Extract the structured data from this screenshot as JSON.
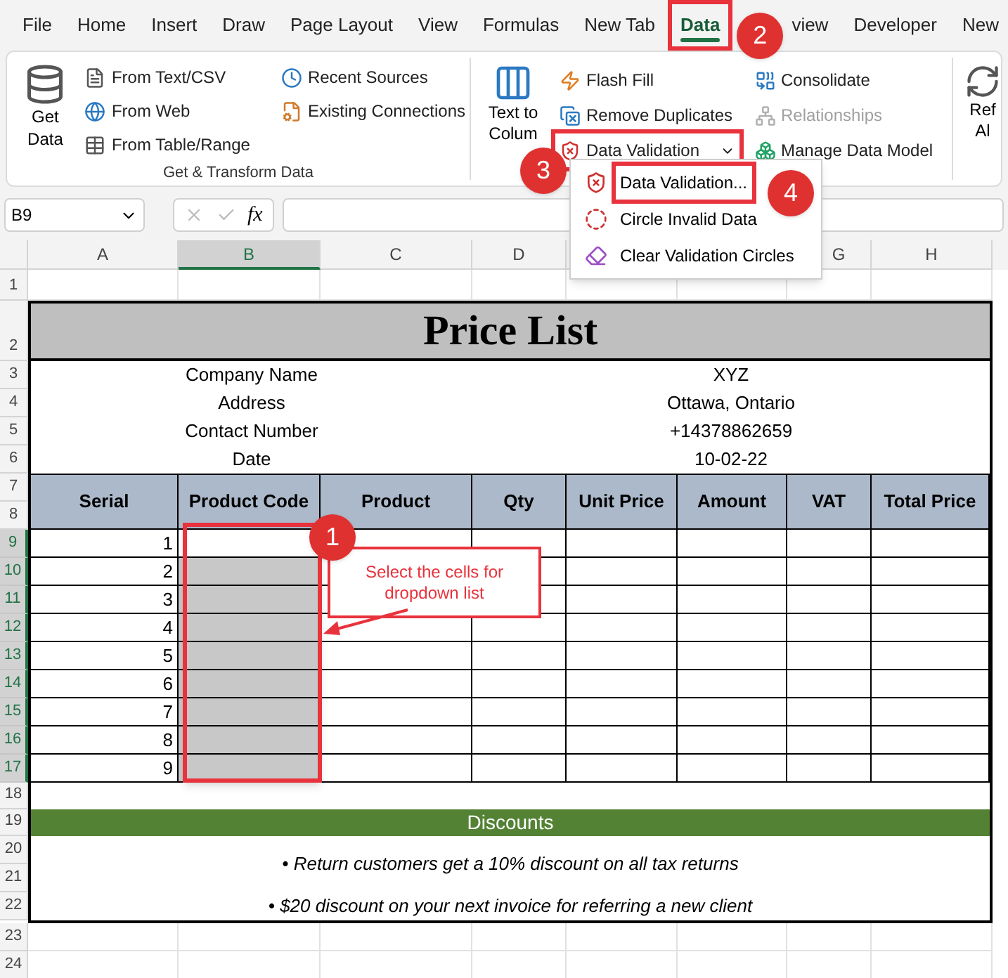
{
  "tabs": [
    {
      "label": "File",
      "selected": false,
      "highlighted": false
    },
    {
      "label": "Home",
      "selected": false,
      "highlighted": false
    },
    {
      "label": "Insert",
      "selected": false,
      "highlighted": false
    },
    {
      "label": "Draw",
      "selected": false,
      "highlighted": false
    },
    {
      "label": "Page Layout",
      "selected": false,
      "highlighted": false
    },
    {
      "label": "View",
      "selected": false,
      "highlighted": false
    },
    {
      "label": "Formulas",
      "selected": false,
      "highlighted": false
    },
    {
      "label": "New Tab",
      "selected": false,
      "highlighted": false
    },
    {
      "label": "Data",
      "selected": true,
      "highlighted": true
    },
    {
      "label": "view",
      "selected": false,
      "highlighted": false
    },
    {
      "label": "Developer",
      "selected": false,
      "highlighted": false
    },
    {
      "label": "New",
      "selected": false,
      "highlighted": false
    }
  ],
  "ribbon": {
    "get_data": {
      "label": "Get Data"
    },
    "get_items": [
      {
        "label": "From Text/CSV"
      },
      {
        "label": "From Web"
      },
      {
        "label": "From Table/Range"
      }
    ],
    "source_items": [
      {
        "label": "Recent Sources"
      },
      {
        "label": "Existing Connections"
      }
    ],
    "get_group_label": "Get & Transform Data",
    "text_to_columns": {
      "lines": [
        "Text to",
        "Colum"
      ]
    },
    "tool_items": [
      {
        "label": "Flash Fill",
        "disabled": false,
        "highlighted": false,
        "caret": false
      },
      {
        "label": "Remove Duplicates",
        "disabled": false,
        "highlighted": false,
        "caret": false
      },
      {
        "label": "Data Validation",
        "disabled": false,
        "highlighted": true,
        "caret": true
      }
    ],
    "model_items": [
      {
        "label": "Consolidate",
        "disabled": false
      },
      {
        "label": "Relationships",
        "disabled": true
      },
      {
        "label": "Manage Data Model",
        "disabled": false
      }
    ],
    "refresh": {
      "lines": [
        "Ref",
        "Al"
      ]
    }
  },
  "formula_bar": {
    "name_box": "B9",
    "fx": "fx"
  },
  "menu": {
    "items": [
      {
        "label": "Data Validation...",
        "highlighted": true
      },
      {
        "label": "Circle Invalid Data",
        "highlighted": false
      },
      {
        "label": "Clear Validation Circles",
        "highlighted": false
      }
    ]
  },
  "sheet": {
    "columns": [
      {
        "label": "A",
        "selected": false
      },
      {
        "label": "B",
        "selected": true
      },
      {
        "label": "C",
        "selected": false
      },
      {
        "label": "D",
        "selected": false
      },
      {
        "label": "G",
        "selected": false
      },
      {
        "label": "H",
        "selected": false
      }
    ],
    "title": "Price List",
    "info": [
      {
        "row": "3",
        "label": "Company Name",
        "value": "XYZ"
      },
      {
        "row": "4",
        "label": "Address",
        "value": "Ottawa, Ontario"
      },
      {
        "row": "5",
        "label": "Contact Number",
        "value": "+14378862659"
      },
      {
        "row": "6",
        "label": "Date",
        "value": "10-02-22"
      }
    ],
    "header_rows": [
      "7",
      "8"
    ],
    "headers": [
      "Serial",
      "Product Code",
      "Product",
      "Qty",
      "Unit Price",
      "Amount",
      "VAT",
      "Total Price"
    ],
    "rows": [
      {
        "row": "9",
        "serial": "1",
        "selected": true,
        "shaded": false
      },
      {
        "row": "10",
        "serial": "2",
        "selected": true,
        "shaded": true
      },
      {
        "row": "11",
        "serial": "3",
        "selected": true,
        "shaded": true
      },
      {
        "row": "12",
        "serial": "4",
        "selected": true,
        "shaded": true
      },
      {
        "row": "13",
        "serial": "5",
        "selected": true,
        "shaded": true
      },
      {
        "row": "14",
        "serial": "6",
        "selected": true,
        "shaded": true
      },
      {
        "row": "15",
        "serial": "7",
        "selected": true,
        "shaded": true
      },
      {
        "row": "16",
        "serial": "8",
        "selected": true,
        "shaded": true
      },
      {
        "row": "17",
        "serial": "9",
        "selected": true,
        "shaded": true
      }
    ],
    "empty_rows_before": [
      "1"
    ],
    "title_row": "2",
    "spacer_row": "18",
    "discounts": {
      "row": "19",
      "title": "Discounts",
      "notes": [
        {
          "rows": [
            "20",
            "21"
          ],
          "text": "• Return customers get a 10% discount on all tax returns"
        },
        {
          "rows": [
            "22"
          ],
          "text": "• $20 discount on your next invoice for referring a new client"
        }
      ]
    },
    "empty_rows_after": [
      "23",
      "24"
    ]
  },
  "annotations": {
    "badges": [
      "1",
      "2",
      "3",
      "4"
    ],
    "note": "Select the cells for dropdown list"
  }
}
